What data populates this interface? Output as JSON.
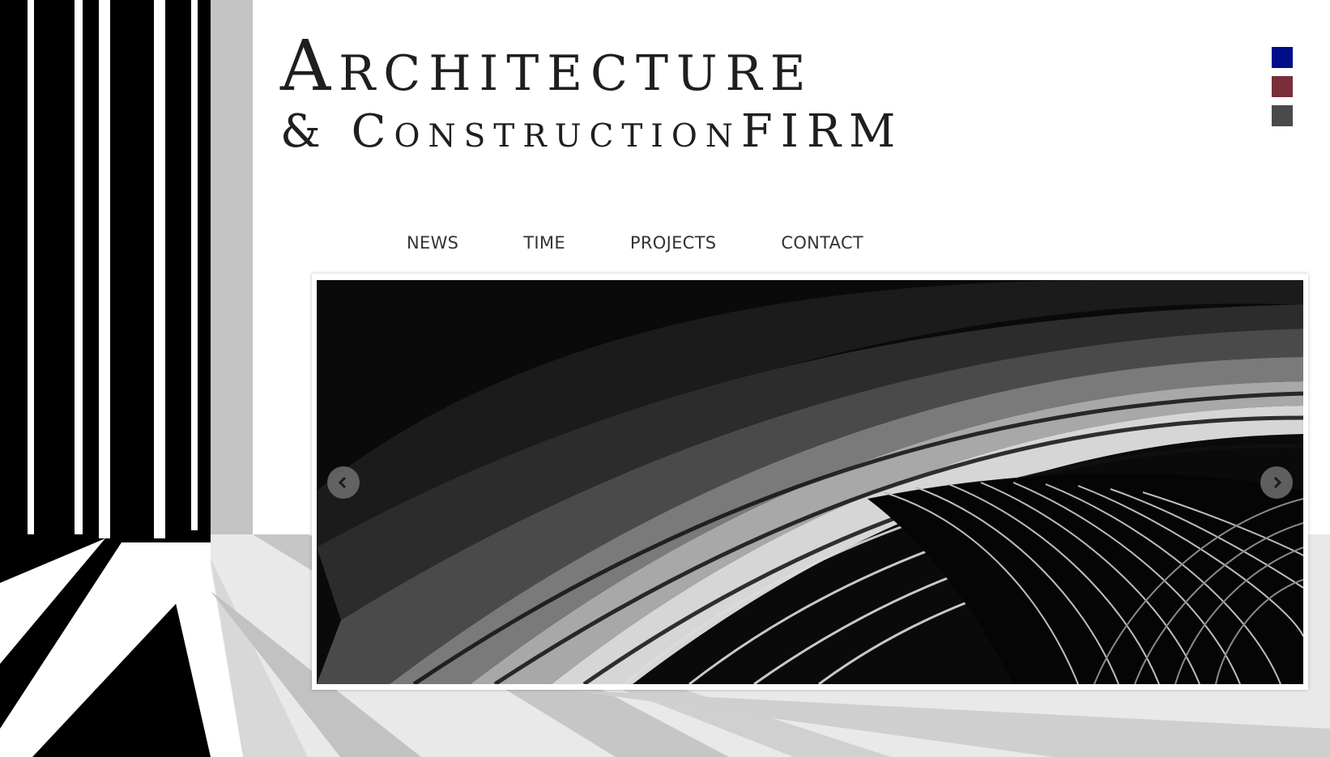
{
  "header": {
    "title_line1": "Architecture",
    "title_line2": "& ConstructionFIRM"
  },
  "color_swatches": [
    {
      "name": "navy",
      "color": "#000d8a"
    },
    {
      "name": "maroon",
      "color": "#7a2e3a"
    },
    {
      "name": "charcoal",
      "color": "#4a4a4a"
    }
  ],
  "nav": {
    "items": [
      {
        "label": "NEWS"
      },
      {
        "label": "TIME"
      },
      {
        "label": "PROJECTS"
      },
      {
        "label": "CONTACT"
      }
    ]
  },
  "slider": {
    "prev_icon": "chevron-left-icon",
    "next_icon": "chevron-right-icon"
  }
}
